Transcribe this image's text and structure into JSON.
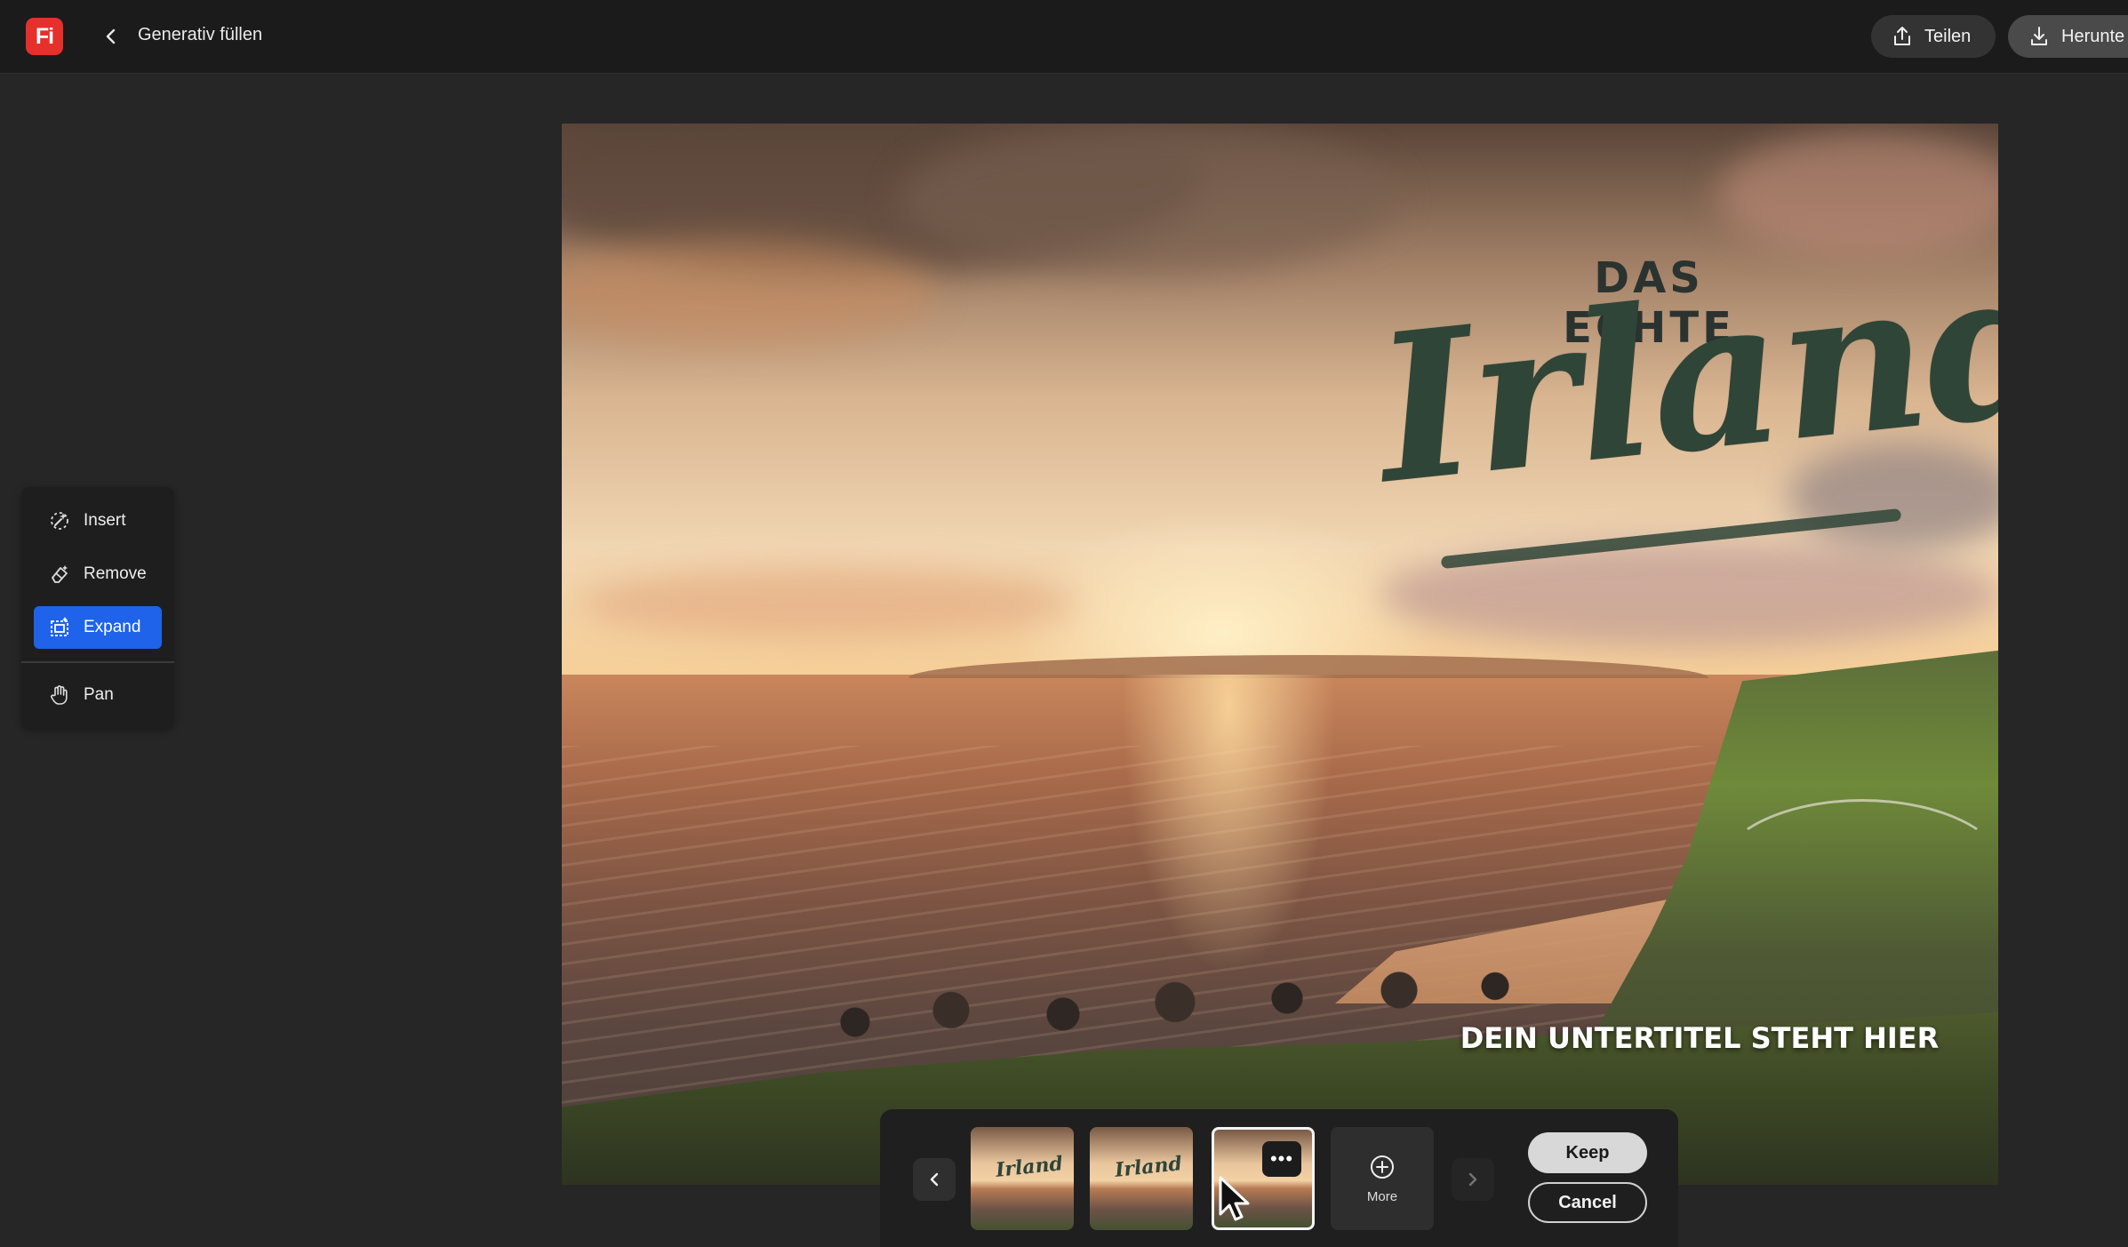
{
  "app": {
    "logo_text": "Fi",
    "title": "Generativ füllen",
    "share_label": "Teilen",
    "download_label": "Herunte"
  },
  "tools": {
    "items": [
      {
        "label": "Insert",
        "icon": "insert-brush-icon"
      },
      {
        "label": "Remove",
        "icon": "eraser-icon"
      },
      {
        "label": "Expand",
        "icon": "expand-frame-icon",
        "active": true
      },
      {
        "label": "Pan",
        "icon": "hand-icon"
      }
    ]
  },
  "canvas": {
    "headline_small": "DAS ECHTE",
    "headline_big": "Irland",
    "subtitle": "DEIN UNTERTITEL STEHT HIER"
  },
  "variations": {
    "thumb_word": "Irland",
    "selected_index": 2,
    "more_dots": "•••",
    "more_label": "More",
    "keep_label": "Keep",
    "cancel_label": "Cancel"
  },
  "colors": {
    "accent": "#1e63e9",
    "logo_bg": "#e5302b",
    "topbar_bg": "#1b1b1b",
    "app_bg": "#262626"
  }
}
